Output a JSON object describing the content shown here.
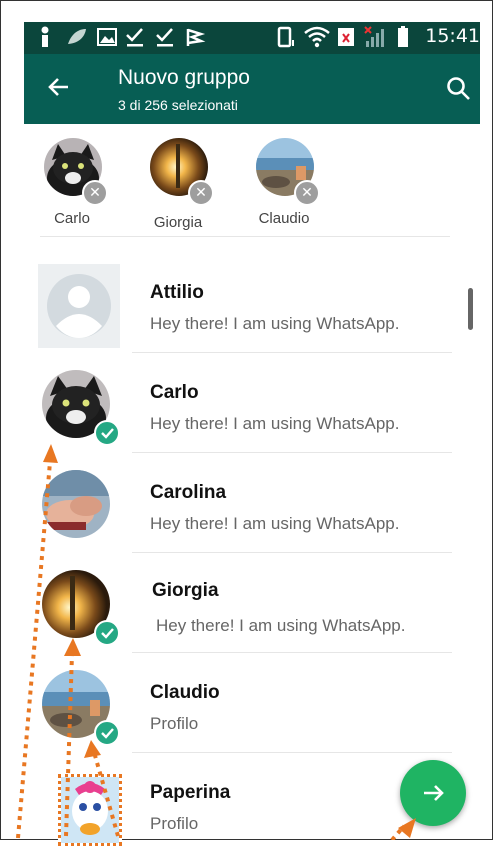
{
  "status_bar": {
    "time": "15:41",
    "icons": [
      "person-pin-icon",
      "leaf-icon",
      "image-icon",
      "check-download-icon",
      "check-download-icon",
      "flag-icon",
      "vibrate-icon",
      "wifi-icon",
      "battery-saver-icon",
      "signal-icon",
      "battery-icon"
    ]
  },
  "app_bar": {
    "title": "Nuovo gruppo",
    "subtitle": "3 di 256 selezionati",
    "back_icon": "arrow-back-icon",
    "search_icon": "search-icon",
    "color": "#075e54"
  },
  "selected": [
    {
      "name": "Carlo",
      "avatar": "black-white-cat-photo"
    },
    {
      "name": "Giorgia",
      "avatar": "sunset-candle-photo"
    },
    {
      "name": "Claudio",
      "avatar": "beach-photo"
    }
  ],
  "contacts": [
    {
      "name": "Attilio",
      "status": "Hey there! I am using WhatsApp.",
      "selected": false,
      "avatar": "default-avatar"
    },
    {
      "name": "Carlo",
      "status": "Hey there! I am using WhatsApp.",
      "selected": true,
      "avatar": "black-white-cat-photo"
    },
    {
      "name": "Carolina",
      "status": "Hey there! I am using WhatsApp.",
      "selected": false,
      "avatar": "hands-photo"
    },
    {
      "name": "Giorgia",
      "status": "Hey there! I am using WhatsApp.",
      "selected": true,
      "avatar": "sunset-candle-photo"
    },
    {
      "name": "Claudio",
      "status": "Profilo",
      "selected": true,
      "avatar": "beach-photo"
    },
    {
      "name": "Paperina",
      "status": "Profilo",
      "selected": false,
      "avatar": "daisy-duck-image"
    }
  ],
  "fab": {
    "icon": "arrow-forward-icon",
    "color": "#1fb463"
  },
  "accent_check_color": "#25a884",
  "annotation_color": "#e87722"
}
